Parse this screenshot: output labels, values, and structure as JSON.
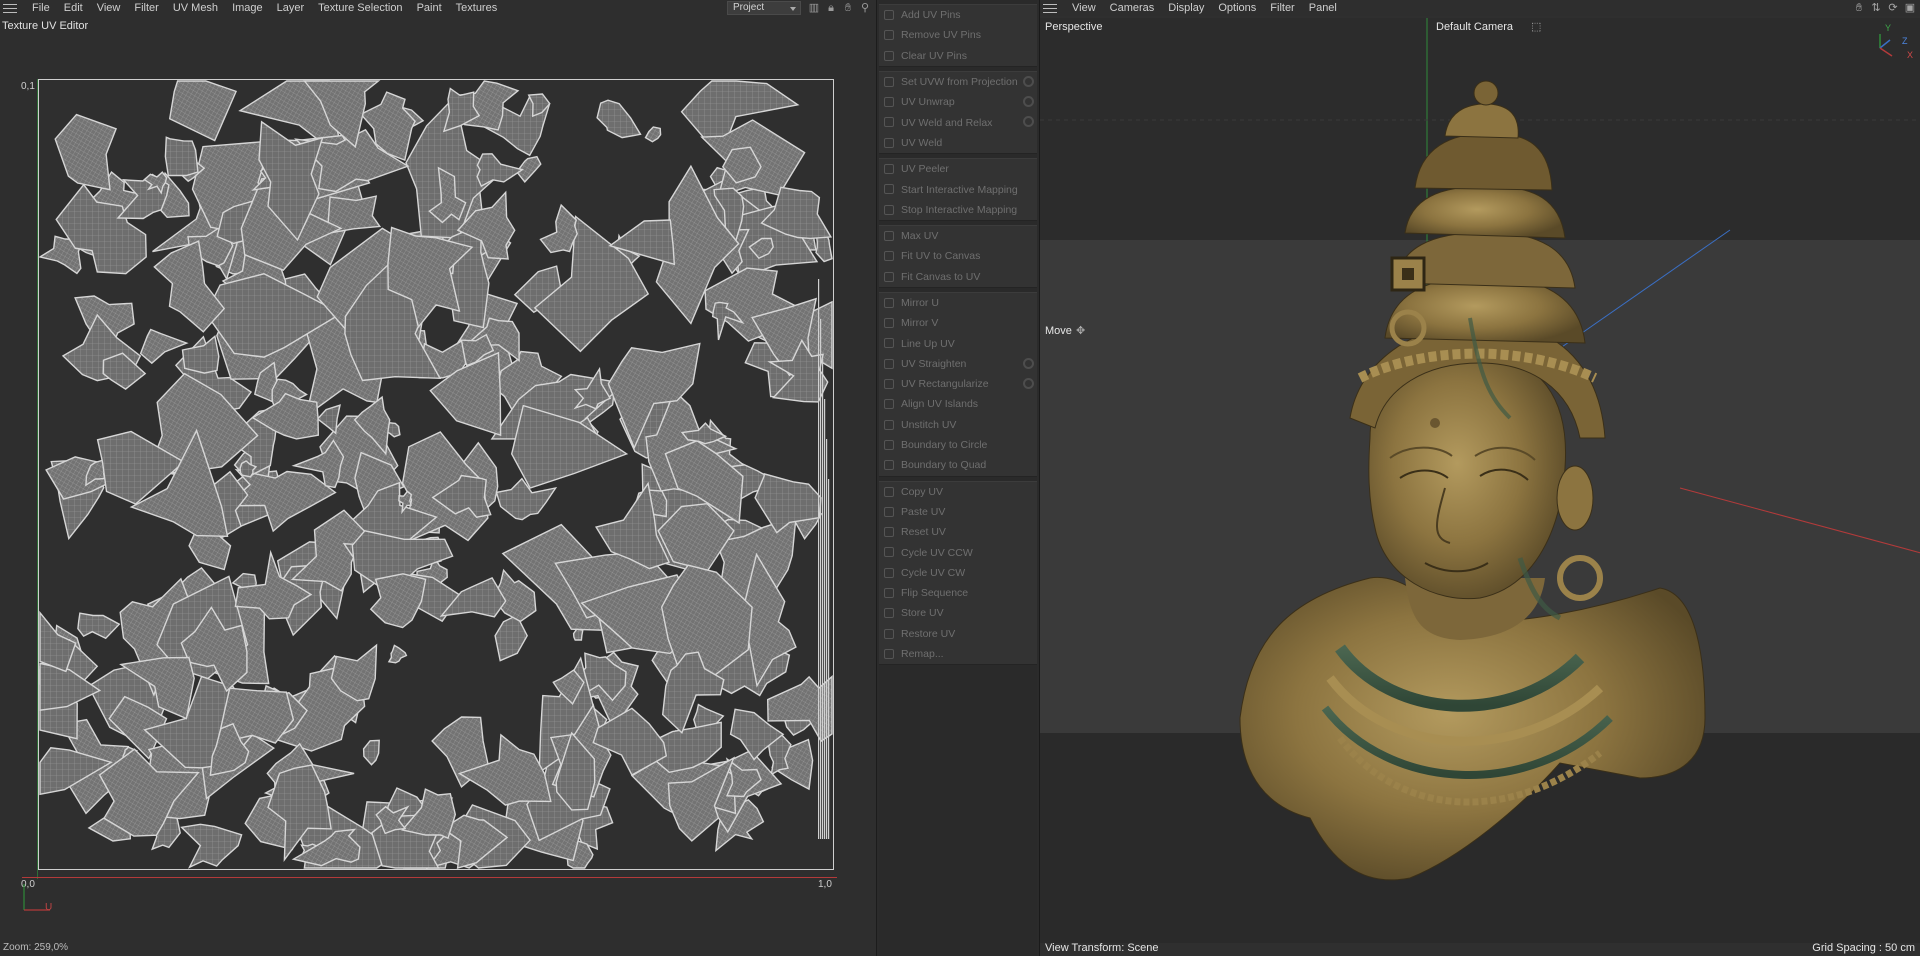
{
  "uv_editor": {
    "menu": [
      "File",
      "Edit",
      "View",
      "Filter",
      "UV Mesh",
      "Image",
      "Layer",
      "Texture Selection",
      "Paint",
      "Textures"
    ],
    "project_dropdown": "Project",
    "title": "Texture UV Editor",
    "coord_top_left": "0,1",
    "coord_bottom_left": "0,0",
    "coord_bottom_right": "1,0",
    "gizmo_label": "U",
    "zoom": "Zoom: 259,0%"
  },
  "tools": {
    "groups": [
      [
        {
          "label": "Add UV Pins",
          "gear": false
        },
        {
          "label": "Remove UV Pins",
          "gear": false
        },
        {
          "label": "Clear UV Pins",
          "gear": false
        }
      ],
      [
        {
          "label": "Set UVW from Projection",
          "gear": true
        },
        {
          "label": "UV Unwrap",
          "gear": true
        },
        {
          "label": "UV Weld and Relax",
          "gear": true
        },
        {
          "label": "UV Weld",
          "gear": false
        }
      ],
      [
        {
          "label": "UV Peeler",
          "gear": false
        },
        {
          "label": "Start Interactive Mapping",
          "gear": false
        },
        {
          "label": "Stop Interactive Mapping",
          "gear": false
        }
      ],
      [
        {
          "label": "Max UV",
          "gear": false
        },
        {
          "label": "Fit UV to Canvas",
          "gear": false
        },
        {
          "label": "Fit Canvas to UV",
          "gear": false
        }
      ],
      [
        {
          "label": "Mirror U",
          "gear": false
        },
        {
          "label": "Mirror V",
          "gear": false
        },
        {
          "label": "Line Up UV",
          "gear": false
        },
        {
          "label": "UV Straighten",
          "gear": true
        },
        {
          "label": "UV Rectangularize",
          "gear": true
        },
        {
          "label": "Align UV Islands",
          "gear": false
        },
        {
          "label": "Unstitch UV",
          "gear": false
        },
        {
          "label": "Boundary to Circle",
          "gear": false
        },
        {
          "label": "Boundary to Quad",
          "gear": false
        }
      ],
      [
        {
          "label": "Copy UV",
          "gear": false
        },
        {
          "label": "Paste UV",
          "gear": false
        },
        {
          "label": "Reset UV",
          "gear": false
        },
        {
          "label": "Cycle UV CCW",
          "gear": false
        },
        {
          "label": "Cycle UV CW",
          "gear": false
        },
        {
          "label": "Flip Sequence",
          "gear": false
        },
        {
          "label": "Store UV",
          "gear": false
        },
        {
          "label": "Restore UV",
          "gear": false
        },
        {
          "label": "Remap...",
          "gear": false
        }
      ]
    ]
  },
  "viewport": {
    "menu": [
      "View",
      "Cameras",
      "Display",
      "Options",
      "Filter",
      "Panel"
    ],
    "projection": "Perspective",
    "camera": "Default Camera",
    "tool": "Move",
    "view_transform": "View Transform: Scene",
    "grid_spacing": "Grid Spacing : 50 cm",
    "axis_y": "Y",
    "axis_z": "Z",
    "axis_x": "X"
  },
  "colors": {
    "uv_wire": "#bfbfbf",
    "uv_fill": "#7a7a7a",
    "bronze": "#8c7440",
    "patina": "#3f5a44",
    "axis_x": "#b33a3a",
    "axis_y": "#2f8a3a",
    "axis_z": "#3a6fc4"
  }
}
